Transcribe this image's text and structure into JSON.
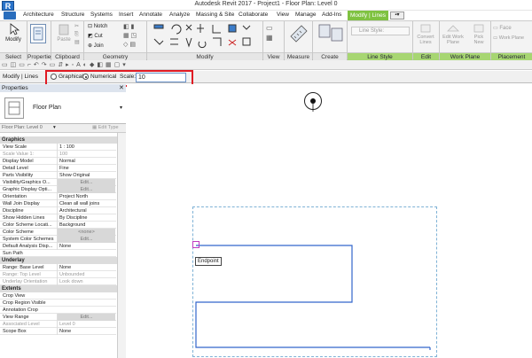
{
  "app": {
    "logo": "R",
    "title": "Autodesk Revit 2017 -    Project1 - Floor Plan: Level 0"
  },
  "tabs": [
    "Architecture",
    "Structure",
    "Systems",
    "Insert",
    "Annotate",
    "Analyze",
    "Massing & Site",
    "Collaborate",
    "View",
    "Manage",
    "Add-Ins"
  ],
  "context_tab": "Modify | Lines",
  "ribbon": {
    "modify_label": "Modify",
    "paste_label": "Paste",
    "clipboard_items": [],
    "geometry_items": [
      "Notch",
      "Cut",
      "Join"
    ],
    "line_style_label": "Line Style:",
    "convert_label": "Convert Lines",
    "edit_workplane_label": "Edit Work Plane",
    "pick_new_label": "Pick New",
    "face_label": "Face",
    "workplane_label": "Work Plane",
    "panels": [
      "Select",
      "Properties",
      "Clipboard",
      "Geometry",
      "Modify",
      "View",
      "Measure",
      "Create",
      "Line Style",
      "Edit",
      "Work Plane",
      "Placement"
    ]
  },
  "optionsbar": {
    "context": "Modify | Lines",
    "graphical": "Graphical",
    "numerical": "Numerical",
    "scale_label": "Scale:",
    "scale_value": "10"
  },
  "properties": {
    "title": "Properties",
    "type_name": "Floor Plan",
    "instance": "Floor Plan: Level 0",
    "edit_type": "Edit Type",
    "groups": [
      {
        "name": "Graphics",
        "rows": [
          {
            "k": "View Scale",
            "v": "1 : 100"
          },
          {
            "k": "Scale Value    1:",
            "v": "100",
            "dis": true
          },
          {
            "k": "Display Model",
            "v": "Normal"
          },
          {
            "k": "Detail Level",
            "v": "Fine"
          },
          {
            "k": "Parts Visibility",
            "v": "Show Original"
          },
          {
            "k": "Visibility/Graphics O...",
            "v": "Edit...",
            "btn": true
          },
          {
            "k": "Graphic Display Opti...",
            "v": "Edit...",
            "btn": true
          },
          {
            "k": "Orientation",
            "v": "Project North"
          },
          {
            "k": "Wall Join Display",
            "v": "Clean all wall joins"
          },
          {
            "k": "Discipline",
            "v": "Architectural"
          },
          {
            "k": "Show Hidden Lines",
            "v": "By Discipline"
          },
          {
            "k": "Color Scheme Locati...",
            "v": "Background"
          },
          {
            "k": "Color Scheme",
            "v": "<none>",
            "btn": true
          },
          {
            "k": "System Color Schemes",
            "v": "Edit...",
            "btn": true
          },
          {
            "k": "Default Analysis Disp...",
            "v": "None"
          },
          {
            "k": "Sun Path",
            "v": ""
          }
        ]
      },
      {
        "name": "Underlay",
        "rows": [
          {
            "k": "Range: Base Level",
            "v": "None"
          },
          {
            "k": "Range: Top Level",
            "v": "Unbounded",
            "dis": true
          },
          {
            "k": "Underlay Orientation",
            "v": "Look down",
            "dis": true
          }
        ]
      },
      {
        "name": "Extents",
        "rows": [
          {
            "k": "Crop View",
            "v": ""
          },
          {
            "k": "Crop Region Visible",
            "v": ""
          },
          {
            "k": "Annotation Crop",
            "v": ""
          },
          {
            "k": "View Range",
            "v": "Edit...",
            "btn": true
          },
          {
            "k": "Associated Level",
            "v": "Level 0",
            "dis": true
          },
          {
            "k": "Scope Box",
            "v": "None"
          }
        ]
      }
    ]
  },
  "canvas": {
    "tooltip": "Endpoint"
  }
}
